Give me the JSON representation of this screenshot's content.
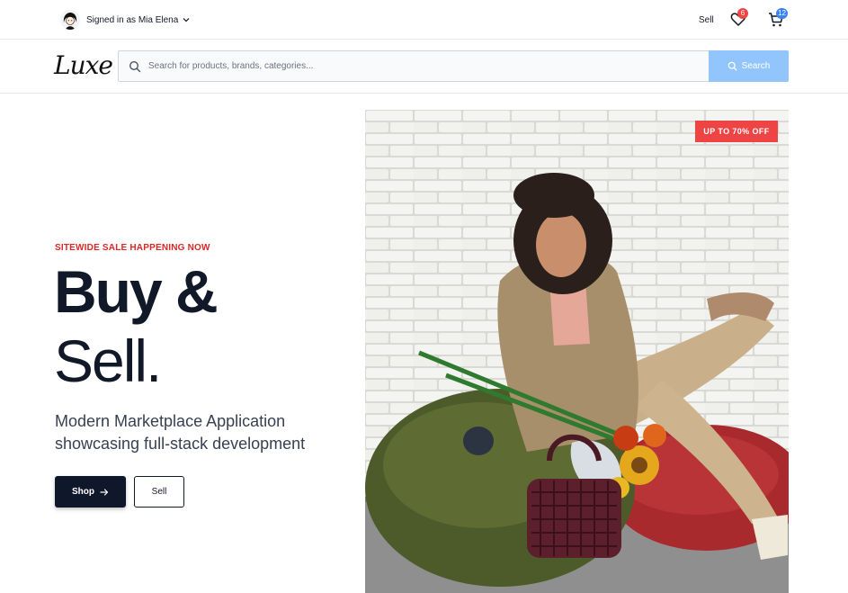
{
  "topbar": {
    "signed_in_text": "Signed in as Mia Elena",
    "sell_label": "Sell",
    "wishlist_count": "6",
    "cart_count": "12"
  },
  "header": {
    "logo_text": "Luxe",
    "search_placeholder": "Search for products, brands, categories...",
    "search_value": "",
    "search_button_label": "Search"
  },
  "hero": {
    "kicker": "SITEWIDE SALE HAPPENING NOW",
    "title_line1": "Buy &",
    "title_line2": "Sell.",
    "description_line1": "Modern Marketplace Application",
    "description_line2": "showcasing full-stack development",
    "shop_button_label": "Shop",
    "sell_button_label": "Sell",
    "sale_badge": "UP TO 70% OFF"
  },
  "colors": {
    "accent_red": "#ef4444",
    "kicker_red": "#dc2626",
    "search_button_blue": "#93c5fd",
    "cart_badge_blue": "#3b82f6",
    "primary_dark": "#0f172a"
  },
  "icons": {
    "user_menu_chevron": "chevron-down-icon",
    "wishlist": "heart-icon",
    "cart": "cart-icon",
    "search": "search-icon",
    "shop_arrow": "arrow-right-icon"
  }
}
